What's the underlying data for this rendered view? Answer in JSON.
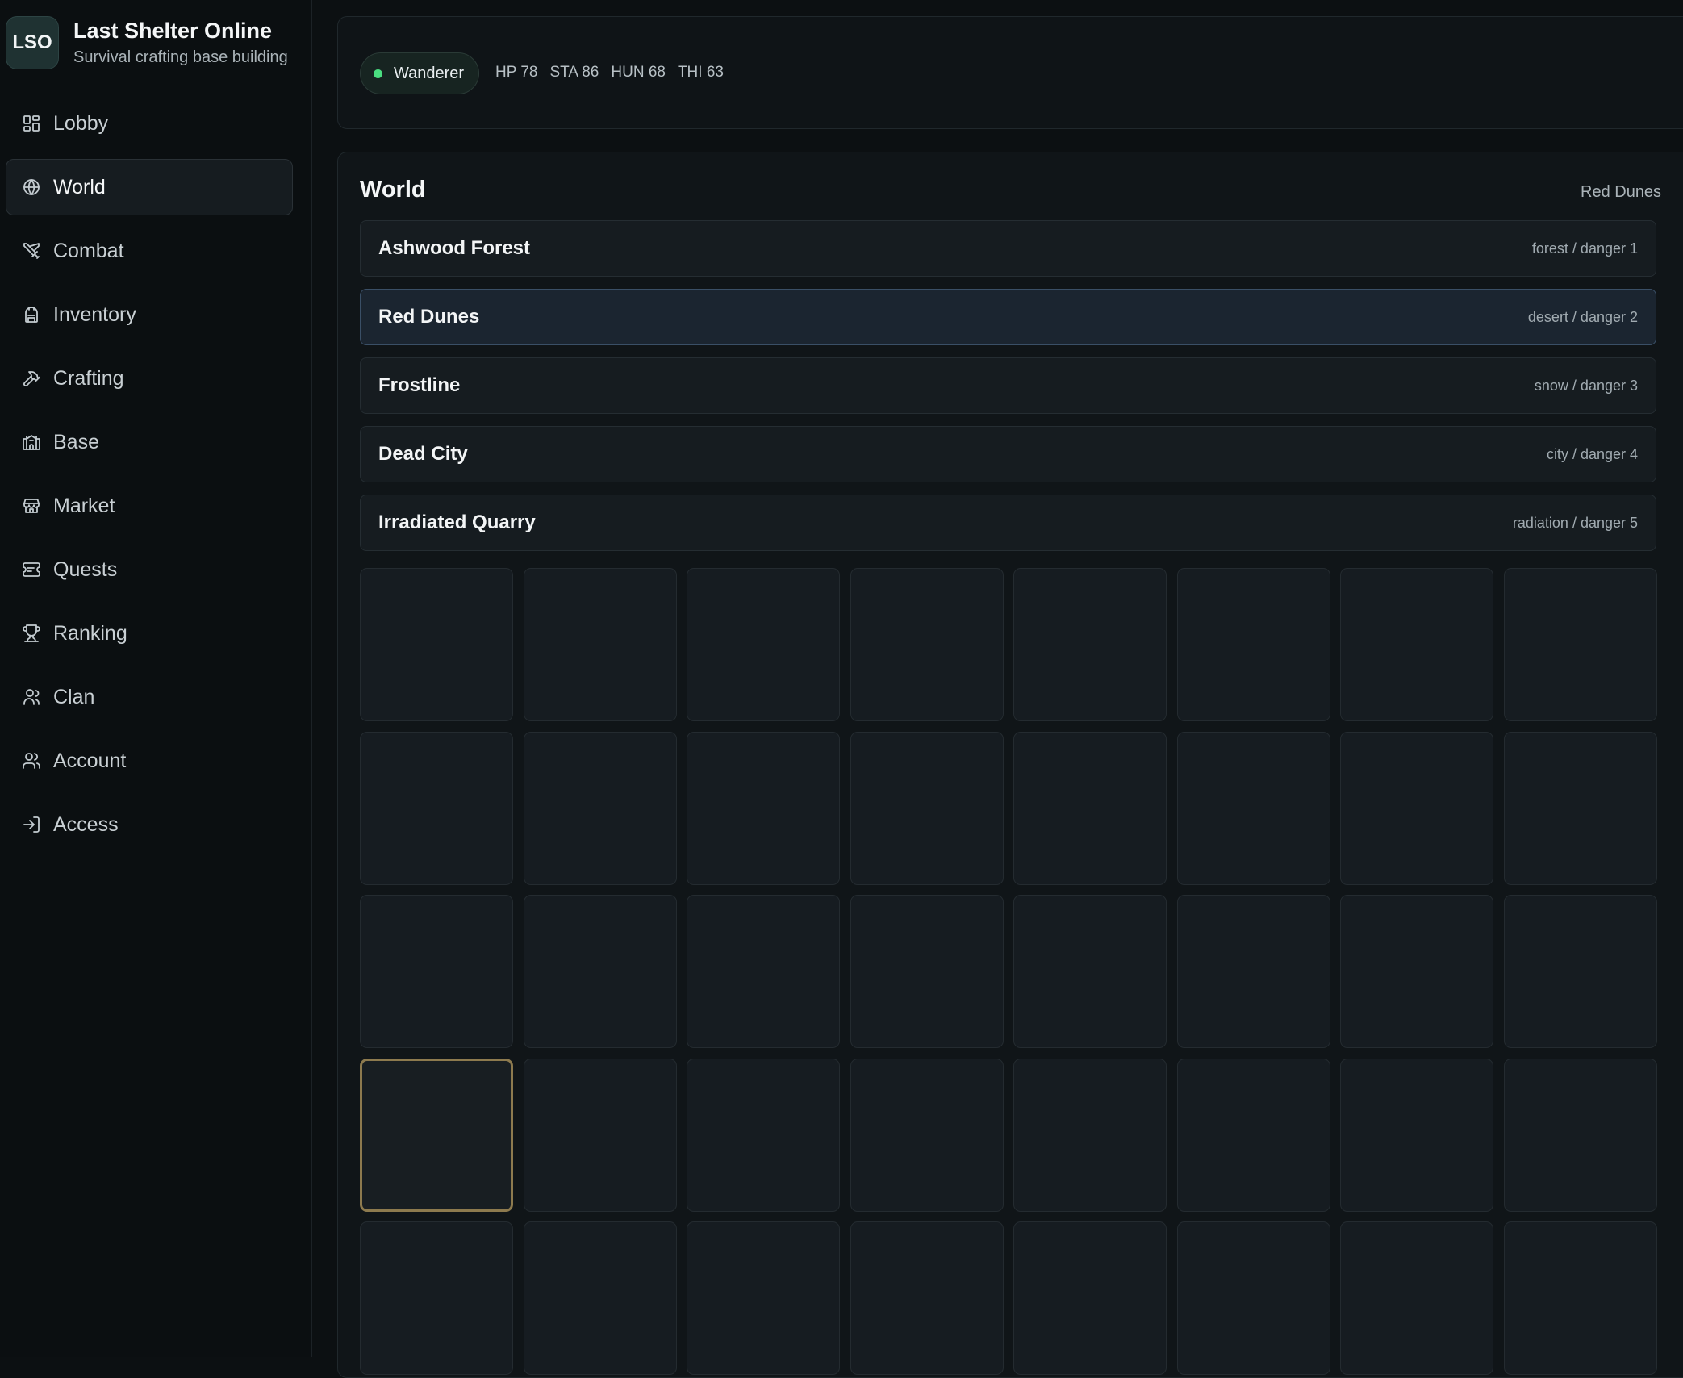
{
  "app": {
    "logo_text": "LSO",
    "title": "Last Shelter Online",
    "subtitle": "Survival crafting base building"
  },
  "nav": {
    "items": [
      {
        "label": "Lobby",
        "icon": "grid-icon"
      },
      {
        "label": "World",
        "icon": "globe-icon",
        "active": true
      },
      {
        "label": "Combat",
        "icon": "swords-icon"
      },
      {
        "label": "Inventory",
        "icon": "backpack-icon"
      },
      {
        "label": "Crafting",
        "icon": "hammer-icon"
      },
      {
        "label": "Base",
        "icon": "castle-icon"
      },
      {
        "label": "Market",
        "icon": "store-icon"
      },
      {
        "label": "Quests",
        "icon": "ticket-icon"
      },
      {
        "label": "Ranking",
        "icon": "trophy-icon"
      },
      {
        "label": "Clan",
        "icon": "user-group-icon"
      },
      {
        "label": "Account",
        "icon": "users-icon"
      },
      {
        "label": "Access",
        "icon": "login-icon"
      }
    ]
  },
  "status": {
    "player_name": "Wanderer",
    "online_color": "#4ade80",
    "hp": "HP 78",
    "sta": "STA 86",
    "hun": "HUN 68",
    "thi": "THI 63"
  },
  "world": {
    "title": "World",
    "current_region": "Red Dunes",
    "regions": [
      {
        "name": "Ashwood Forest",
        "meta": "forest / danger 1"
      },
      {
        "name": "Red Dunes",
        "meta": "desert / danger 2",
        "selected": true
      },
      {
        "name": "Frostline",
        "meta": "snow / danger 3"
      },
      {
        "name": "Dead City",
        "meta": "city / danger 4"
      },
      {
        "name": "Irradiated Quarry",
        "meta": "radiation / danger 5"
      }
    ],
    "grid": {
      "columns": 8,
      "visible_rows": 5,
      "current_tile": {
        "row": 4,
        "col": 1
      }
    },
    "current_tile_color": "#8d7a4e"
  }
}
